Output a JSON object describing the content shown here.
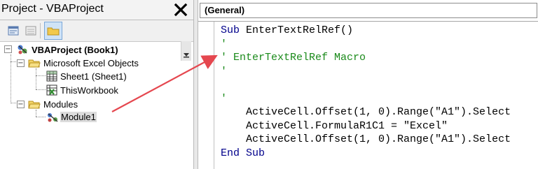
{
  "project_panel": {
    "title": "Project - VBAProject",
    "close_label": "✕",
    "toolbar": [
      "view-code",
      "view-object",
      "toggle-folders"
    ],
    "tree": {
      "root": "VBAProject (Book1)",
      "folders": [
        {
          "label": "Microsoft Excel Objects",
          "items": [
            "Sheet1 (Sheet1)",
            "ThisWorkbook"
          ]
        },
        {
          "label": "Modules",
          "items": [
            "Module1"
          ]
        }
      ],
      "selected": "Module1"
    }
  },
  "code_window": {
    "object_dropdown": "(General)",
    "lines": [
      {
        "parts": [
          {
            "t": "Sub ",
            "c": "kw"
          },
          {
            "t": "EnterTextRelRef()",
            "c": ""
          }
        ]
      },
      {
        "parts": [
          {
            "t": "'",
            "c": "cm"
          }
        ]
      },
      {
        "parts": [
          {
            "t": "' EnterTextRelRef Macro",
            "c": "cm"
          }
        ]
      },
      {
        "parts": [
          {
            "t": "'",
            "c": "cm"
          }
        ]
      },
      {
        "parts": [
          {
            "t": "",
            "c": ""
          }
        ]
      },
      {
        "parts": [
          {
            "t": "'",
            "c": "cm"
          }
        ]
      },
      {
        "parts": [
          {
            "t": "    ActiveCell.Offset(1, 0).Range(\"A1\").Select",
            "c": ""
          }
        ]
      },
      {
        "parts": [
          {
            "t": "    ActiveCell.FormulaR1C1 = \"Excel\"",
            "c": ""
          }
        ]
      },
      {
        "parts": [
          {
            "t": "    ActiveCell.Offset(1, 0).Range(\"A1\").Select",
            "c": ""
          }
        ]
      },
      {
        "parts": [
          {
            "t": "End Sub",
            "c": "kw"
          }
        ]
      }
    ]
  },
  "annotation": {
    "color": "#e5474f"
  }
}
